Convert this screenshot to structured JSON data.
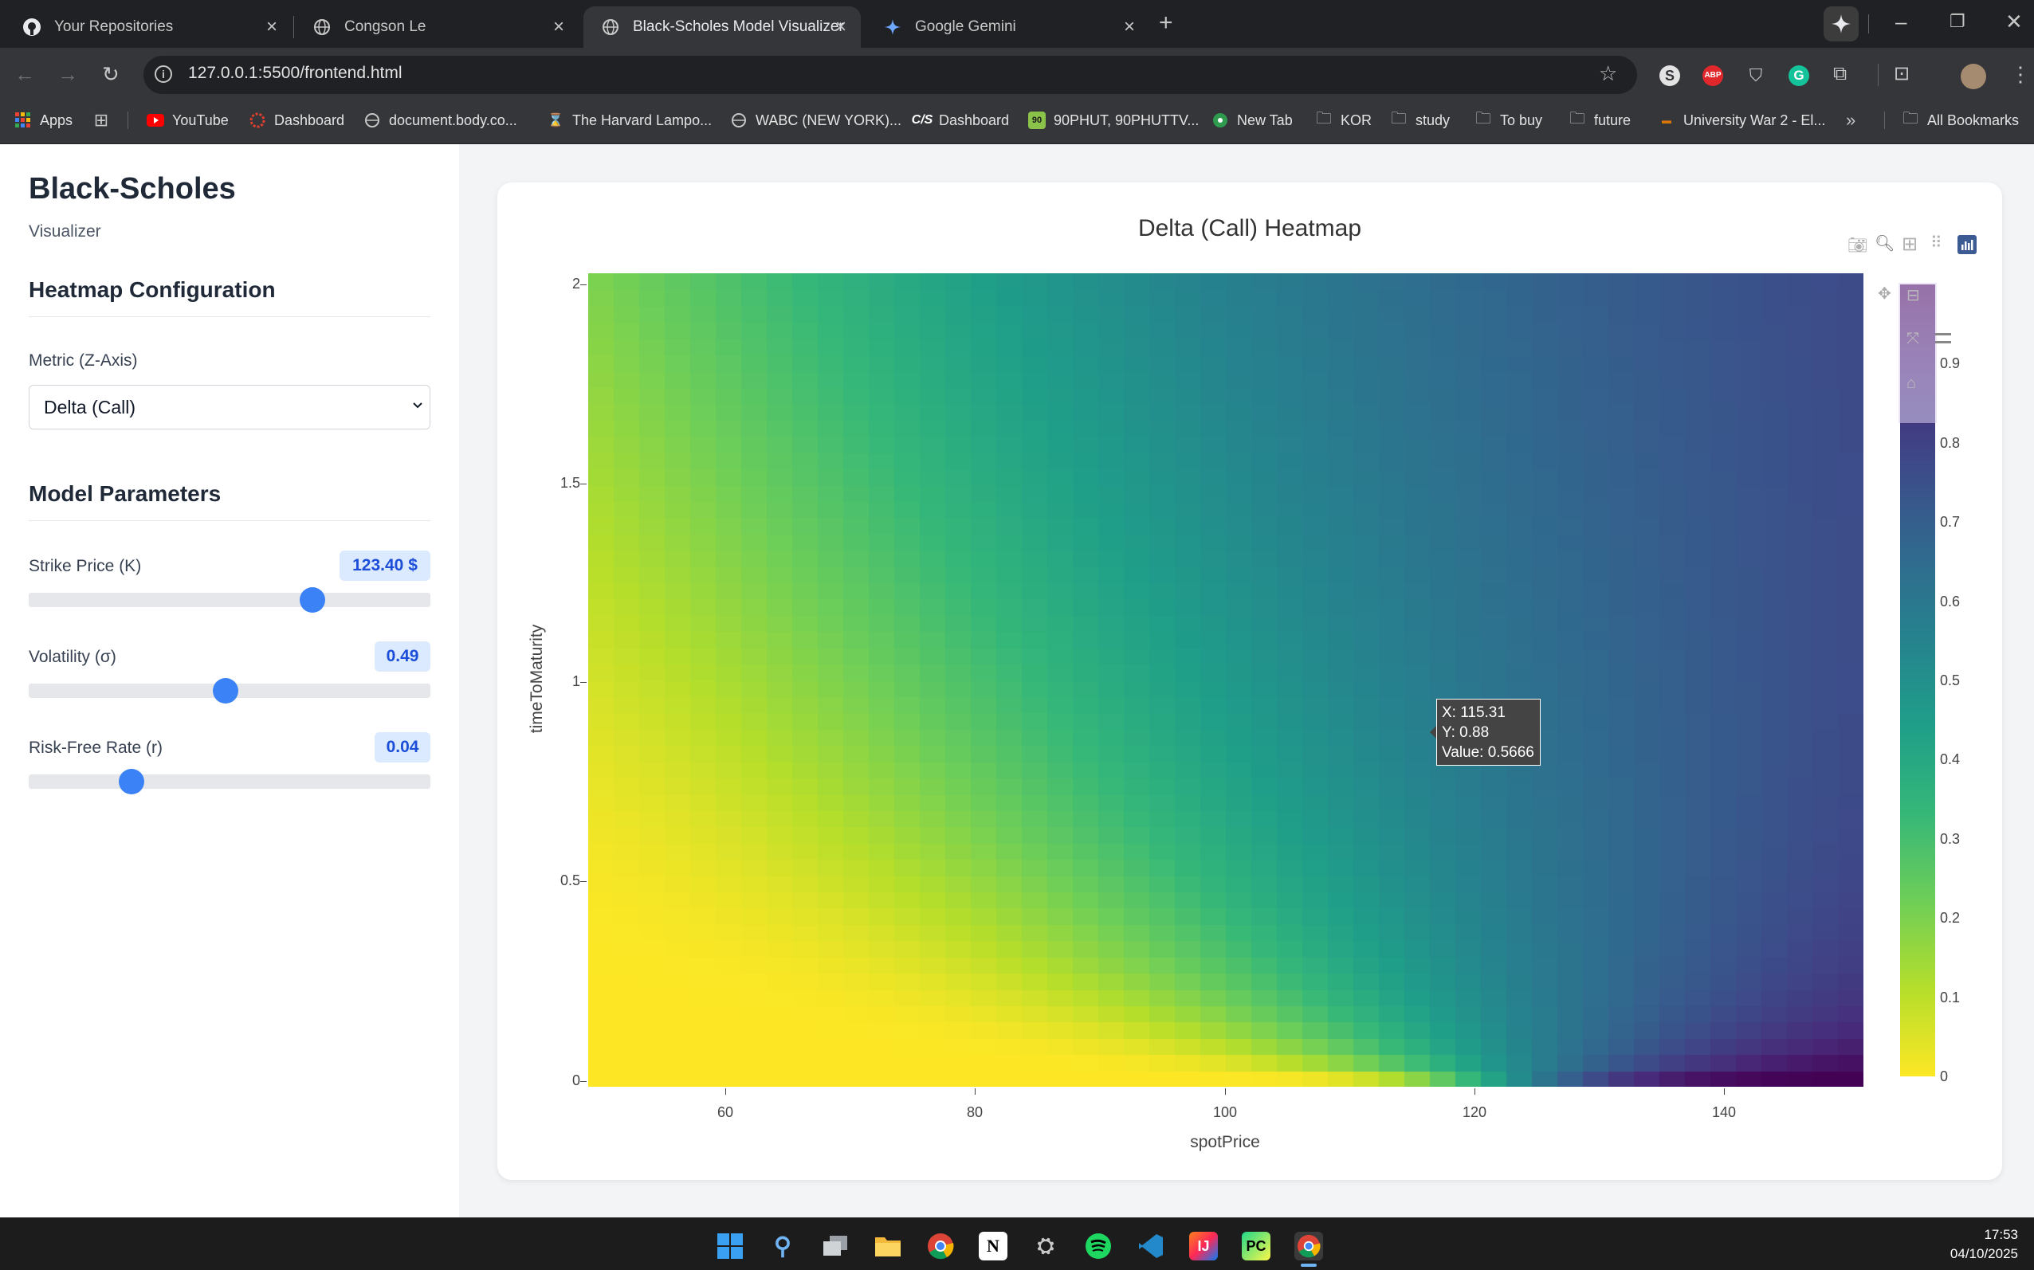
{
  "browser": {
    "tabs": [
      {
        "title": "Your Repositories",
        "icon": "github-icon"
      },
      {
        "title": "Congson Le",
        "icon": "globe-icon"
      },
      {
        "title": "Black-Scholes Model Visualizer",
        "icon": "globe-icon",
        "active": true
      },
      {
        "title": "Google Gemini",
        "icon": "gemini-icon"
      }
    ],
    "url": "127.0.0.1:5500/frontend.html",
    "bookmarks": [
      {
        "label": "Apps",
        "icon": "apps-grid-icon"
      },
      {
        "label": "YouTube",
        "icon": "youtube-icon"
      },
      {
        "label": "Dashboard",
        "icon": "dashboard-icon"
      },
      {
        "label": "document.body.co...",
        "icon": "globe-icon"
      },
      {
        "label": "The Harvard Lampo...",
        "icon": "lampoon-icon"
      },
      {
        "label": "WABC (NEW YORK)...",
        "icon": "globe-icon"
      },
      {
        "label": "Dashboard",
        "icon": "canvas-icon"
      },
      {
        "label": "90PHUT, 90PHUTTV...",
        "icon": "90phut-icon"
      },
      {
        "label": "New Tab",
        "icon": "football-icon"
      },
      {
        "label": "KOR",
        "icon": "folder-icon"
      },
      {
        "label": "study",
        "icon": "folder-icon"
      },
      {
        "label": "To buy",
        "icon": "folder-icon"
      },
      {
        "label": "future",
        "icon": "folder-icon"
      },
      {
        "label": "University War 2 - El...",
        "icon": "site-icon"
      }
    ],
    "all_bookmarks": "All Bookmarks"
  },
  "sidebar": {
    "title": "Black-Scholes",
    "subtitle": "Visualizer",
    "config_heading": "Heatmap Configuration",
    "metric_label": "Metric (Z-Axis)",
    "metric_value": "Delta (Call)",
    "params_heading": "Model Parameters",
    "params": [
      {
        "label": "Strike Price (K)",
        "value": "123.40 $",
        "fraction": 0.72
      },
      {
        "label": "Volatility (σ)",
        "value": "0.49",
        "fraction": 0.49
      },
      {
        "label": "Risk-Free Rate (r)",
        "value": "0.04",
        "fraction": 0.24
      }
    ]
  },
  "chart_data": {
    "type": "heatmap",
    "title": "Delta (Call) Heatmap",
    "xlabel": "spotPrice",
    "ylabel": "timeToMaturity",
    "xlim": [
      49,
      151
    ],
    "ylim": [
      0,
      2.03
    ],
    "x_ticks": [
      "60",
      "80",
      "100",
      "120",
      "140"
    ],
    "y_ticks": [
      "0",
      "0.5",
      "1",
      "1.5",
      "2"
    ],
    "colorscale": "Viridis (reversed)",
    "colorbar_ticks": [
      "0",
      "0.1",
      "0.2",
      "0.3",
      "0.4",
      "0.5",
      "0.6",
      "0.7",
      "0.8",
      "0.9"
    ],
    "zlim": [
      0,
      1
    ],
    "params": {
      "strike": 123.4,
      "volatility": 0.49,
      "rate": 0.04
    },
    "hover": {
      "x": "X: 115.31",
      "y": "Y: 0.88",
      "value": "Value: 0.5666"
    }
  },
  "clock": {
    "time": "17:53",
    "date": "04/10/2025"
  }
}
